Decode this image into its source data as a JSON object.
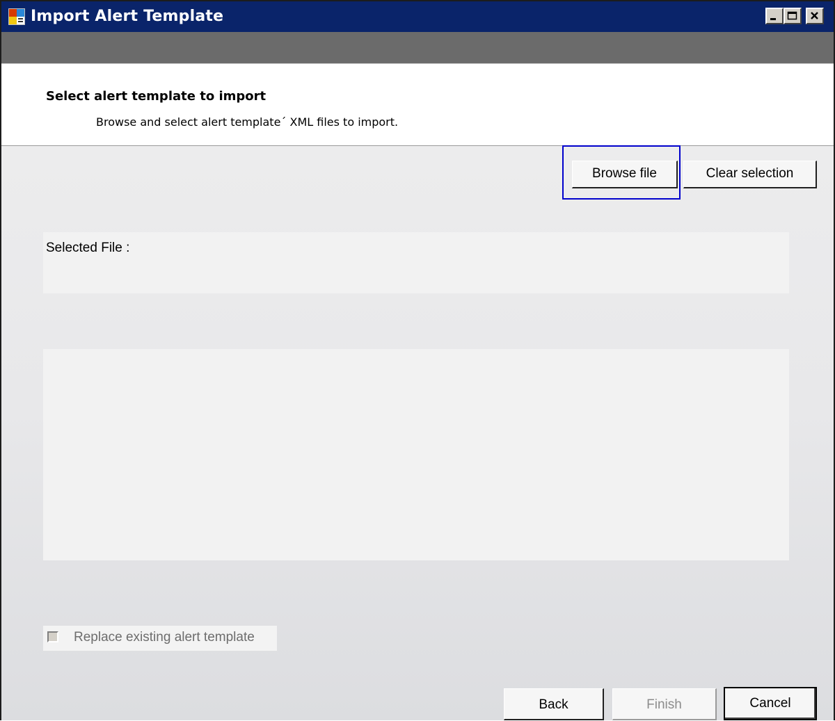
{
  "window": {
    "title": "Import Alert Template",
    "accent_color": "#0a246a",
    "icon": "app-icon"
  },
  "header": {
    "title": "Select alert template to import",
    "description": "Browse and select alert template´ XML files to import."
  },
  "toolbar": {
    "browse_label": "Browse file",
    "clear_label": "Clear selection"
  },
  "selected_file": {
    "label": "Selected File :"
  },
  "options": {
    "replace_label": "Replace existing alert template",
    "replace_checked": false
  },
  "footer": {
    "back_label": "Back",
    "finish_label": "Finish",
    "cancel_label": "Cancel"
  }
}
